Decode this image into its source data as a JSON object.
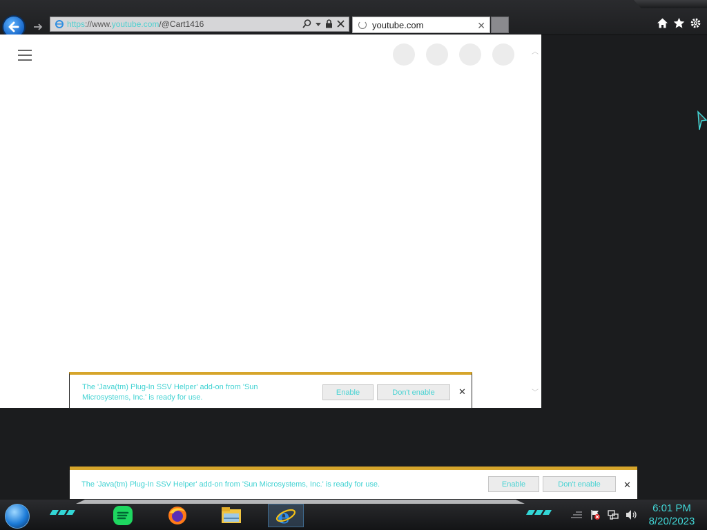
{
  "browser": {
    "address": {
      "proto": "https",
      "rest": "://www.",
      "host": "youtube.com",
      "path": "/@Cart1416"
    },
    "tab": {
      "label": "youtube.com"
    }
  },
  "notifications": {
    "top": {
      "message": "The 'Java(tm) Plug-In SSV Helper' add-on from 'Sun Microsystems, Inc.' is ready for use.",
      "enable_label": "Enable",
      "dont_enable_label": "Don't enable"
    },
    "bottom": {
      "message": "The 'Java(tm) Plug-In SSV Helper' add-on from 'Sun Microsystems, Inc.' is ready for use.",
      "enable_label": "Enable",
      "dont_enable_label": "Don't enable"
    }
  },
  "taskbar": {
    "apps": [
      "spotify-icon",
      "firefox-icon",
      "file-explorer-icon",
      "internet-explorer-icon"
    ],
    "clock": {
      "time": "6:01 PM",
      "date": "8/20/2023"
    }
  },
  "colors": {
    "accent": "#41d6d6",
    "notification_bar": "#d6a52b",
    "back_button": "#1a73d9"
  }
}
